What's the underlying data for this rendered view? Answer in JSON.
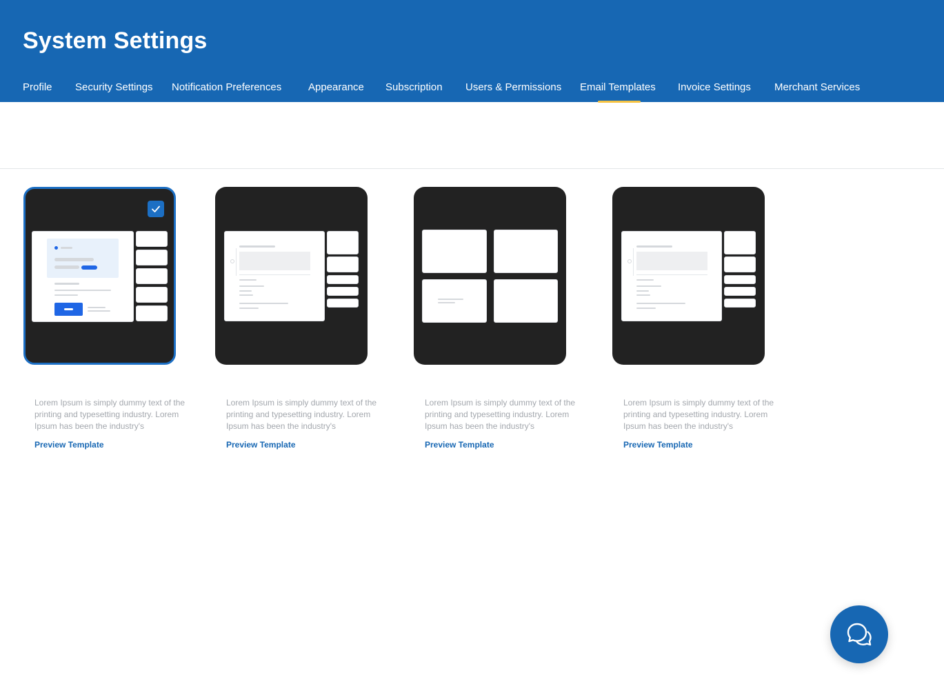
{
  "header": {
    "title": "System Settings"
  },
  "tabs": [
    {
      "label": "Profile"
    },
    {
      "label": "Security Settings"
    },
    {
      "label": "Notification Preferences"
    },
    {
      "label": "Appearance"
    },
    {
      "label": "Subscription"
    },
    {
      "label": "Users & Permissions"
    },
    {
      "label": "Email Templates"
    },
    {
      "label": "Invoice Settings"
    },
    {
      "label": "Merchant Services"
    }
  ],
  "active_tab": "Email Templates",
  "colors": {
    "brand": "#1767B3",
    "active_underline": "#F5C242",
    "card_bg": "#222222",
    "selected_border": "#1C6FC4"
  },
  "templates": [
    {
      "selected": true,
      "description": "Lorem Ipsum is simply dummy text of the printing and typesetting industry. Lorem Ipsum has been the industry's",
      "link": "Preview Template"
    },
    {
      "selected": false,
      "description": "Lorem Ipsum is simply dummy text of the printing and typesetting industry. Lorem Ipsum has been the industry's",
      "link": "Preview Template"
    },
    {
      "selected": false,
      "description": "Lorem Ipsum is simply dummy text of the printing and typesetting industry. Lorem Ipsum has been the industry's",
      "link": "Preview Template"
    },
    {
      "selected": false,
      "description": "Lorem Ipsum is simply dummy text of the printing and typesetting industry. Lorem Ipsum has been the industry's",
      "link": "Preview Template"
    }
  ],
  "icons": {
    "selected_check": "check-icon",
    "chat": "chat-bubbles-icon"
  }
}
